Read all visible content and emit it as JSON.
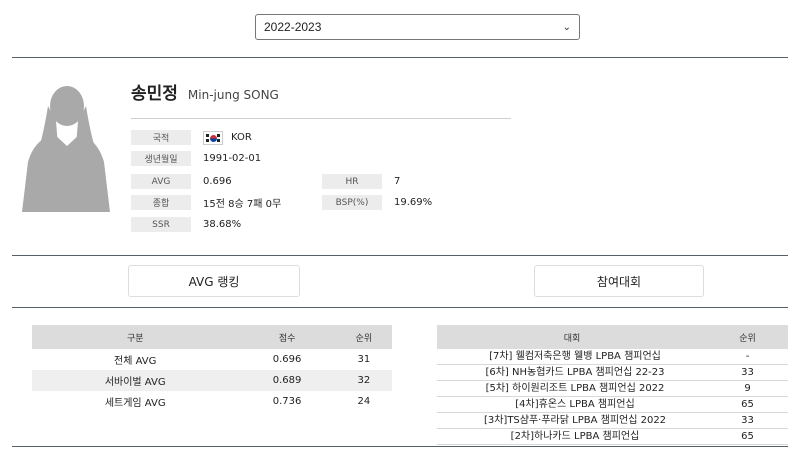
{
  "season_select": {
    "value": "2022-2023"
  },
  "player": {
    "name_ko": "송민정",
    "name_en": "Min-jung SONG"
  },
  "info": {
    "nationality": {
      "label": "국적",
      "value": "KOR"
    },
    "birth": {
      "label": "생년월일",
      "value": "1991-02-01"
    },
    "avg": {
      "label": "AVG",
      "value": "0.696"
    },
    "hr": {
      "label": "HR",
      "value": "7"
    },
    "record": {
      "label": "종합",
      "value": "15전 8승 7패 0무"
    },
    "bsp": {
      "label": "BSP(%)",
      "value": "19.69%"
    },
    "ssr": {
      "label": "SSR",
      "value": "38.68%"
    }
  },
  "tabs": {
    "avg_ranking": "AVG 랭킹",
    "events": "참여대회"
  },
  "rank_table": {
    "headers": [
      "구분",
      "점수",
      "순위"
    ],
    "rows": [
      [
        "전체 AVG",
        "0.696",
        "31"
      ],
      [
        "서바이벌 AVG",
        "0.689",
        "32"
      ],
      [
        "세트게임 AVG",
        "0.736",
        "24"
      ]
    ]
  },
  "event_table": {
    "headers": [
      "대회",
      "순위"
    ],
    "rows": [
      [
        "[7차] 웰컴저축은행 웰뱅 LPBA 챔피언십",
        "-"
      ],
      [
        "[6차] NH농협카드 LPBA 챔피언십 22-23",
        "33"
      ],
      [
        "[5차] 하이원리조트 LPBA 챔피언십 2022",
        "9"
      ],
      [
        "[4차]휴온스 LPBA 챔피언십",
        "65"
      ],
      [
        "[3차]TS샴푸·푸라닭 LPBA 챔피언십 2022",
        "33"
      ],
      [
        "[2차]하나카드 LPBA 챔피언십",
        "65"
      ]
    ]
  }
}
